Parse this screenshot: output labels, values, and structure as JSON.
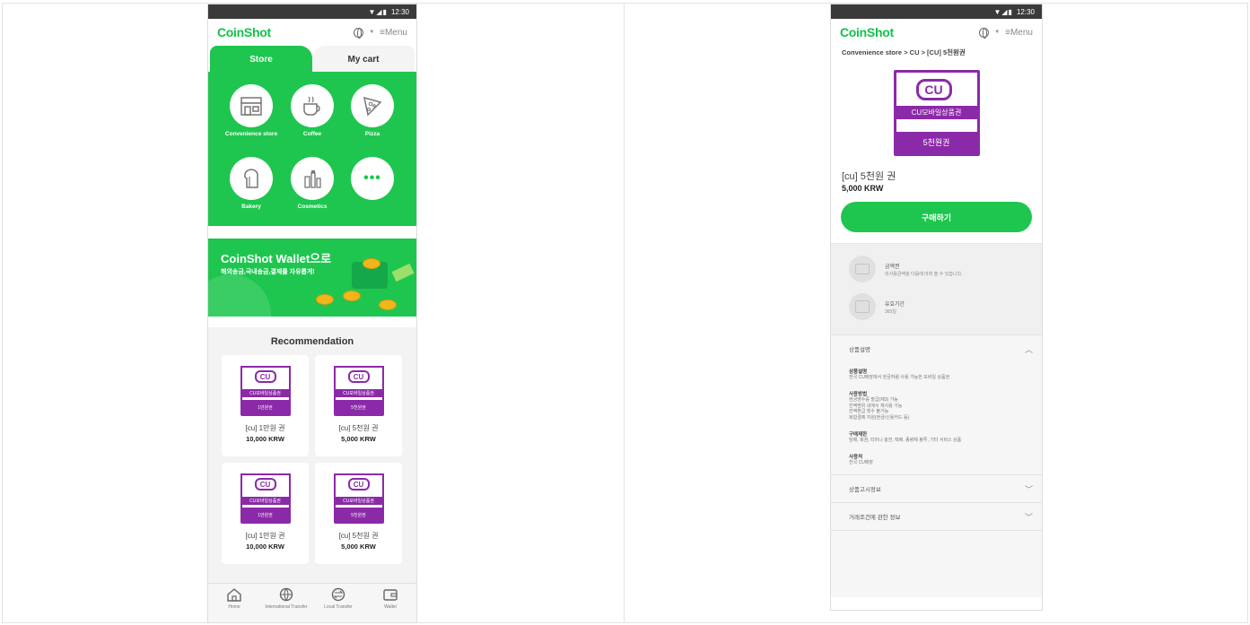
{
  "status_time": "12:30",
  "status_icons": "▼◢▮",
  "app": {
    "logo": "CoinShot",
    "menu_label": "≡Menu"
  },
  "left": {
    "tabs": [
      {
        "label": "Store",
        "active": true
      },
      {
        "label": "My cart",
        "active": false
      }
    ],
    "categories": [
      {
        "label": "Convenience store",
        "icon": "store-icon"
      },
      {
        "label": "Coffee",
        "icon": "coffee-icon"
      },
      {
        "label": "Pizza",
        "icon": "pizza-icon"
      },
      {
        "label": "Bakery",
        "icon": "bread-icon"
      },
      {
        "label": "Cosmetics",
        "icon": "cosmetics-icon"
      },
      {
        "label": "",
        "icon": "more-icon"
      }
    ],
    "banner": {
      "title": "CoinShot Wallet으로",
      "subtitle": "해외송금,국내송금,결제를 자유롭게!"
    },
    "recommendation_title": "Recommendation",
    "products": [
      {
        "brand": "CU모바일상품권",
        "amount": "1만원권",
        "name": "[cu] 1만원 권",
        "price": "10,000 KRW"
      },
      {
        "brand": "CU모바일상품권",
        "amount": "5천원권",
        "name": "[cu] 5천원 권",
        "price": "5,000 KRW"
      },
      {
        "brand": "CU모바일상품권",
        "amount": "1만원권",
        "name": "[cu] 1만원 권",
        "price": "10,000 KRW"
      },
      {
        "brand": "CU모바일상품권",
        "amount": "5천원권",
        "name": "[cu] 5천원 권",
        "price": "5,000 KRW"
      }
    ],
    "cu_badge": "CU",
    "bottom_nav": [
      {
        "label": "Home",
        "icon": "home-icon"
      },
      {
        "label": "International Transfer",
        "icon": "international-transfer-icon"
      },
      {
        "label": "Local Transfer",
        "icon": "local-transfer-icon"
      },
      {
        "label": "Wallet",
        "icon": "wallet-icon"
      }
    ]
  },
  "right": {
    "breadcrumb": "Convenience store > CU > [CU] 5천원권",
    "image_brand": "CU모바일상품권",
    "image_amount": "5천원권",
    "cu_badge": "CU",
    "product_name": "[cu] 5천원 권",
    "product_price": "5,000 KRW",
    "buy_label": "구매하기",
    "info": [
      {
        "title": "금액권",
        "desc": "미사용금액을 다음에 마저 쓸 수 있습니다."
      },
      {
        "title": "유효기간",
        "desc": "365일"
      }
    ],
    "accordions": [
      {
        "title": "상품설명",
        "expanded": true,
        "sections": [
          {
            "title": "상품설명",
            "lines": [
              "전국 CU매장에서 현금처럼 사용 가능한 모바일 상품권"
            ]
          },
          {
            "title": "사용방법",
            "lines": [
              "현금영수증 발급(제3) 가능",
              "잔액범위 내에서 재사용 가능",
              "잔액환급 횟수 불가능",
              "복합결제 지원(현금/신용카드 등)"
            ]
          },
          {
            "title": "구매제한",
            "lines": [
              "담배, 복권, 티머니 충전, 택배, 종량제 봉투, 기타 서비스 상품"
            ]
          },
          {
            "title": "사용처",
            "lines": [
              "전국 CU매장"
            ]
          }
        ]
      },
      {
        "title": "상품고시정보",
        "expanded": false,
        "sections": []
      },
      {
        "title": "거래조건에 관한 정보",
        "expanded": false,
        "sections": []
      }
    ]
  }
}
